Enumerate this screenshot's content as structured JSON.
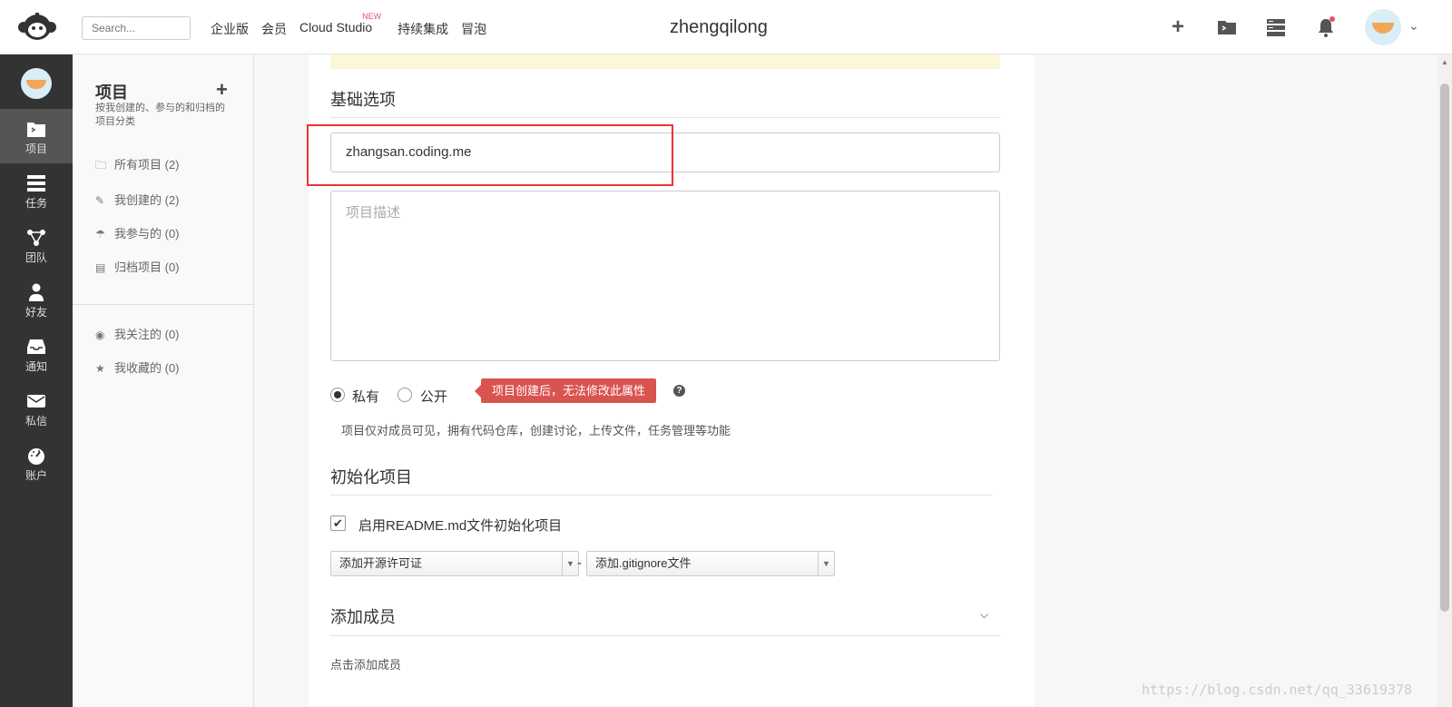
{
  "topbar": {
    "search_placeholder": "Search...",
    "nav": [
      {
        "label": "企业版"
      },
      {
        "label": "会员"
      },
      {
        "label": "Cloud Studio",
        "badge": "NEW"
      },
      {
        "label": "持续集成"
      },
      {
        "label": "冒泡"
      }
    ],
    "brand": "zhengqilong",
    "icons": [
      "plus-icon",
      "folder-icon",
      "tasks-icon",
      "bell-icon",
      "avatar",
      "chevron-down-icon"
    ]
  },
  "sidebar": {
    "items": [
      {
        "label": "项目",
        "icon": "folder-icon",
        "active": true
      },
      {
        "label": "任务",
        "icon": "tasks-icon"
      },
      {
        "label": "团队",
        "icon": "team-icon"
      },
      {
        "label": "好友",
        "icon": "user-icon"
      },
      {
        "label": "通知",
        "icon": "inbox-icon"
      },
      {
        "label": "私信",
        "icon": "mail-icon"
      },
      {
        "label": "账户",
        "icon": "dashboard-icon"
      }
    ]
  },
  "panel": {
    "title": "项目",
    "description": "按我创建的、参与的和归档的项目分类",
    "items": [
      {
        "label": "所有项目 (2)",
        "icon": "folder-icon"
      },
      {
        "label": "我创建的 (2)",
        "icon": "edit-icon"
      },
      {
        "label": "我参与的 (0)",
        "icon": "umbrella-icon"
      },
      {
        "label": "归档项目 (0)",
        "icon": "archive-icon"
      }
    ],
    "extra_items": [
      {
        "label": "我关注的 (0)",
        "icon": "eye-icon"
      },
      {
        "label": "我收藏的 (0)",
        "icon": "star-icon"
      }
    ]
  },
  "form": {
    "basic_title": "基础选项",
    "project_name_value": "zhangsan.coding.me",
    "description_placeholder": "项目描述",
    "radio_private": "私有",
    "radio_public": "公开",
    "tooltip": "项目创建后，无法修改此属性",
    "help_symbol": "?",
    "private_desc": "项目仅对成员可见，拥有代码仓库，创建讨论，上传文件，任务管理等功能",
    "init_title": "初始化项目",
    "readme_checkbox": "启用README.md文件初始化项目",
    "license_select": "添加开源许可证",
    "dash": "-",
    "gitignore_select": "添加.gitignore文件",
    "members_title": "添加成员",
    "members_hint": "点击添加成员"
  },
  "watermark": "https://blog.csdn.net/qq_33619378"
}
